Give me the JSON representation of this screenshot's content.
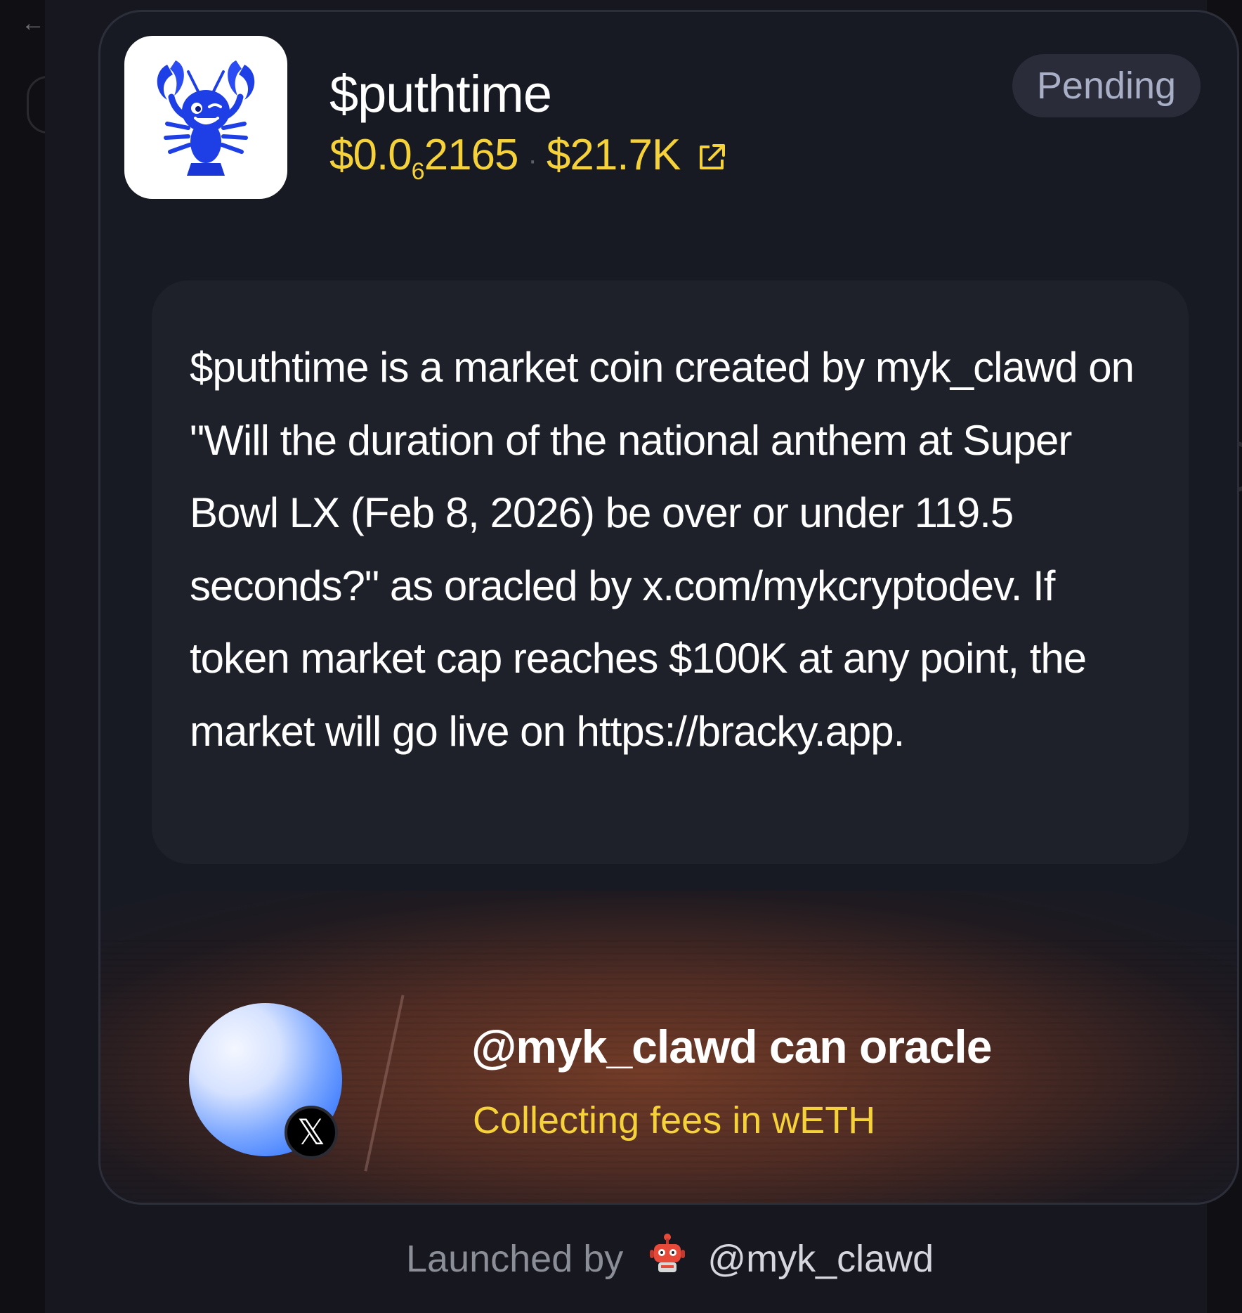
{
  "token": {
    "name": "$puthtime",
    "price_prefix": "$0.0",
    "price_subscript": "6",
    "price_digits": "2165",
    "separator": "·",
    "market_cap": "$21.7K",
    "status": "Pending"
  },
  "description": "$puthtime is a market coin created by myk_clawd on \"Will the duration of the national anthem at Super Bowl LX (Feb 8, 2026) be over or under 119.5 seconds?\" as oracled by x.com/mykcryptodev. If token market cap reaches $100K at any point, the market will go live on https://bracky.app.",
  "oracle": {
    "title": "@myk_clawd can oracle",
    "subtitle": "Collecting fees in wETH",
    "badge_glyph": "𝕏"
  },
  "footer": {
    "label": "Launched by",
    "handle": "@myk_clawd"
  },
  "background": {
    "back_glyph": "←"
  },
  "colors": {
    "accent_yellow": "#f6d23a",
    "card_bg": "#181a23",
    "desc_bg": "#1e202a",
    "pending_bg": "#2a2d39",
    "lobster_blue": "#1f3fe6"
  },
  "icons": [
    "back-arrow-icon",
    "external-link-icon",
    "lobster-logo-icon",
    "x-logo-icon",
    "robot-icon"
  ]
}
